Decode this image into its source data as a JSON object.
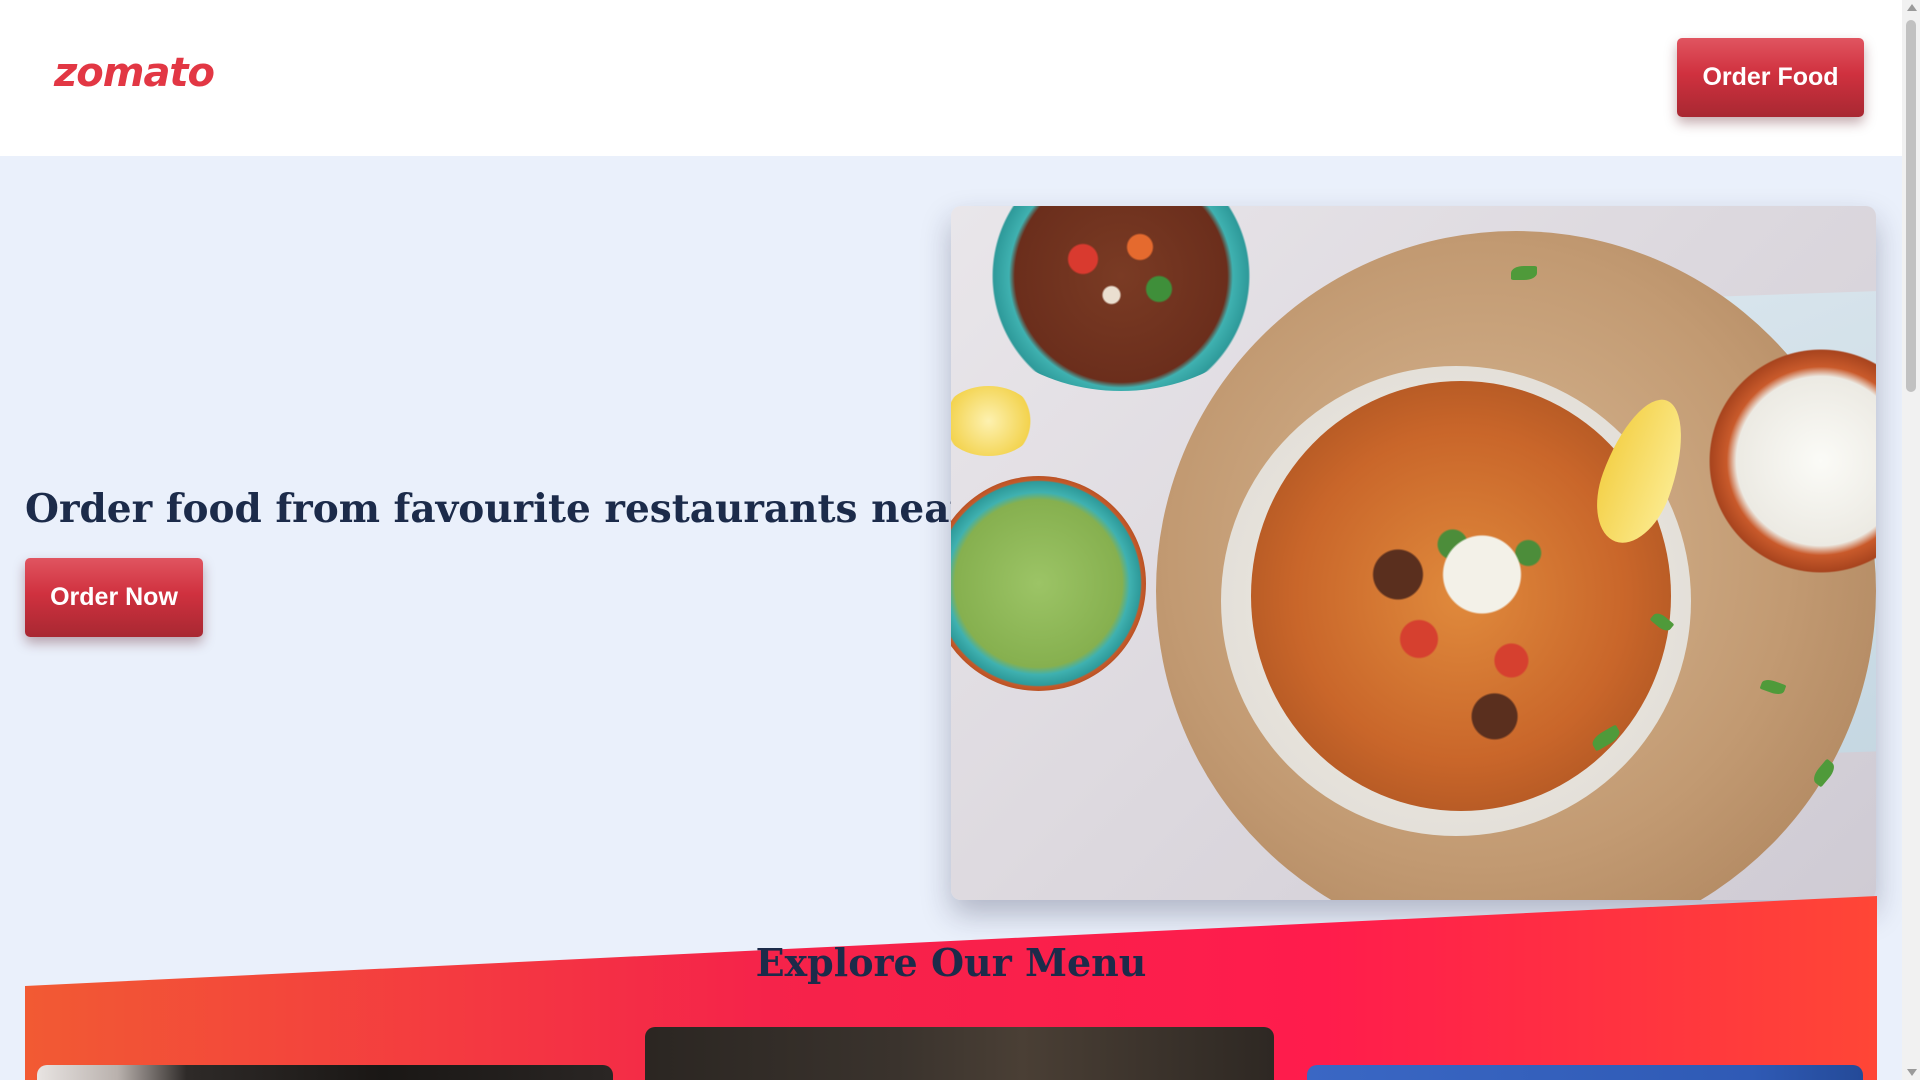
{
  "header": {
    "logo_text": "zomato",
    "order_food_label": "Order Food"
  },
  "hero": {
    "title": "Order food from favourite restaurants near you.",
    "order_now_label": "Order Now",
    "image_icon": "food-platter-image"
  },
  "menu": {
    "title": "Explore Our Menu"
  },
  "colors": {
    "brand": "#e23744",
    "heading": "#1c2b4a",
    "hero_background": "#eaf0fb",
    "band_gradient_start": "#f25a33",
    "band_gradient_mid": "#ff1c4c"
  }
}
